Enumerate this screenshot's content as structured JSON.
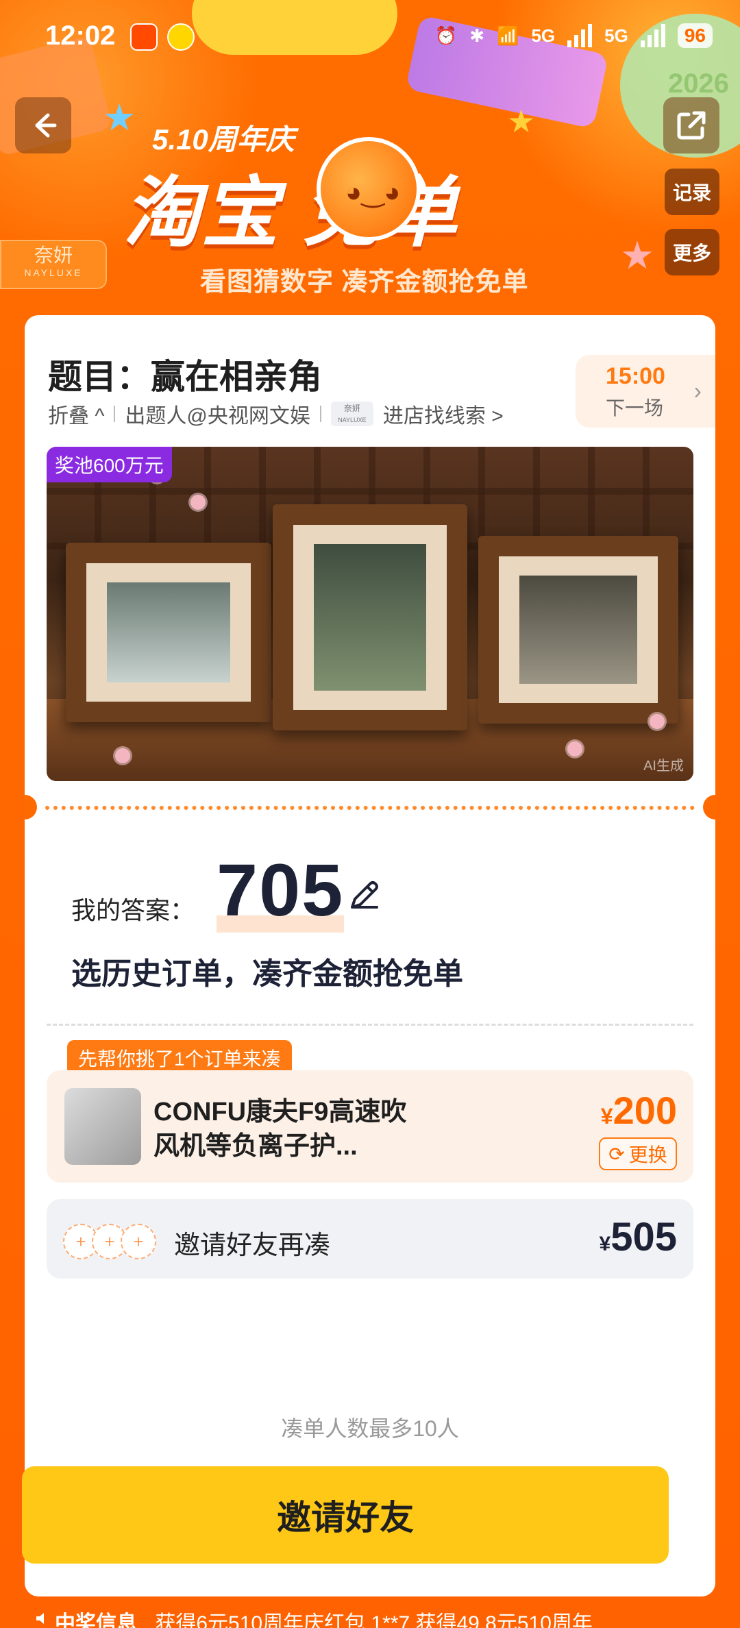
{
  "status_bar": {
    "time": "12:02",
    "battery": "96",
    "network": "5G"
  },
  "header": {
    "event_subtitle": "5.10周年庆",
    "brand_title": "淘宝  免单",
    "tagline": "看图猜数字 凑齐金额抢免单",
    "side_buttons": [
      "记录",
      "更多"
    ],
    "brand_badge_cn": "奈妍",
    "brand_badge_en": "NAYLUXE",
    "deco_text": "2026"
  },
  "question": {
    "title": "题目：赢在相亲角",
    "collapse_label": "折叠 ^",
    "author": "出题人@央视网文娱",
    "shop_mini_cn": "奈妍",
    "shop_mini_en": "NAYLUXE",
    "shop_link": "进店找线索 >",
    "next_round_time": "15:00",
    "next_round_label": "下一场",
    "prize_pool": "奖池600万元",
    "ai_tag": "AI生成"
  },
  "answer": {
    "label": "我的答案：",
    "value": "705",
    "hint": "选历史订单，凑齐金额抢免单"
  },
  "order": {
    "pick_tag": "先帮你挑了1个订单来凑",
    "product_name": "CONFU康夫F9高速吹风机等负离子护...",
    "currency": "¥",
    "price": "200",
    "swap_label": "更换"
  },
  "invite_row": {
    "text": "邀请好友再凑",
    "currency": "¥",
    "amount": "505"
  },
  "footer": {
    "max_note": "凑单人数最多10人",
    "cta_label": "邀请好友",
    "ticker_header": "中奖信息",
    "ticker_text": "获得6元510周年庆红包 1**7 获得49.8元510周年"
  },
  "colors": {
    "primary": "#ff6a00",
    "cta": "#ffc816",
    "accent_purple": "#8a2be2"
  }
}
